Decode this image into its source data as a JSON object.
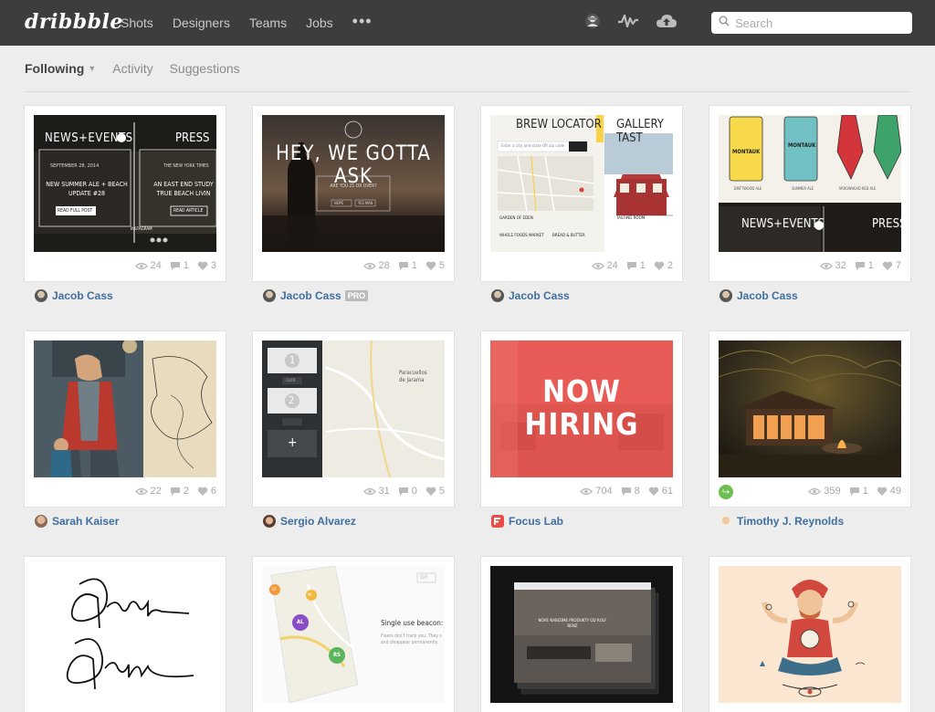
{
  "app": {
    "logo": "dribbble"
  },
  "nav": {
    "items": [
      "Shots",
      "Designers",
      "Teams",
      "Jobs"
    ],
    "more": "•••"
  },
  "search": {
    "placeholder": "Search"
  },
  "subnav": {
    "tabs": [
      "Following",
      "Activity",
      "Suggestions"
    ]
  },
  "shots": [
    {
      "views": "24",
      "comments": "1",
      "likes": "3",
      "author": "Jacob Cass",
      "thumb": {
        "left_title": "NEWS+EVENTS",
        "right_title": "PRESS",
        "date": "SEPTEMBER 28, 2014",
        "headline": "NEW SUMMER ALE + BEACH UPDATE #28",
        "cta": "READ FULL POST",
        "press_src": "THE NEW YORK TIMES",
        "press_headline": "AN EAST END STUDY TRUE BEACH LIVIN",
        "press_cta": "READ ARTICLE",
        "social": "INSTAGRAM"
      }
    },
    {
      "views": "28",
      "comments": "1",
      "likes": "5",
      "author": "Jacob Cass",
      "badge": "PRO",
      "thumb": {
        "headline": "HEY, WE GOTTA ASK",
        "question": "ARE YOU 21 OR OVER?",
        "yes": "NOPE",
        "no": "YES MAN"
      }
    },
    {
      "views": "24",
      "comments": "1",
      "likes": "2",
      "author": "Jacob Cass",
      "thumb": {
        "title": "BREW LOCATOR",
        "title2": "GALLERY TAST",
        "input": "Enter a city and state OR zip code",
        "loc1": "GARDEN OF EDEN",
        "loc2": "WHOLE FOODS MARKET",
        "loc3": "BREAD & BUTTER",
        "room": "TASTING ROOM"
      }
    },
    {
      "views": "32",
      "comments": "1",
      "likes": "7",
      "author": "Jacob Cass",
      "thumb": {
        "can1": "MONTAUK",
        "can2": "MONTAUK",
        "sub1": "DRIFTWOOD ALE",
        "sub2": "SUMMER ALE",
        "sub3": "ARROWHEAD RED ALE",
        "left_title": "NEWS+EVENTS",
        "right_title": "PRESS"
      }
    },
    {
      "views": "22",
      "comments": "2",
      "likes": "6",
      "author": "Sarah Kaiser"
    },
    {
      "views": "31",
      "comments": "0",
      "likes": "5",
      "author": "Sergio Alvarez",
      "thumb": {
        "btn1": "1",
        "btn2": "2",
        "click": "CLICK",
        "plus": "+",
        "city": "Paracuellos de Jarama"
      }
    },
    {
      "views": "704",
      "comments": "8",
      "likes": "61",
      "author": "Focus Lab",
      "thumb": {
        "line1": "NOW",
        "line2": "HIRING"
      }
    },
    {
      "views": "359",
      "comments": "1",
      "likes": "49",
      "author": "Timothy J. Reynolds"
    },
    {
      "author": ""
    },
    {
      "author": "",
      "thumb": {
        "gif": "GIF",
        "title": "Single use beacon:",
        "body": "Flaers don't track you. They s and disappear permanently.",
        "pins": [
          "AL",
          "RS",
          "MC",
          "GT"
        ]
      }
    },
    {
      "author": "",
      "thumb": {
        "caption": "NOVE NABIZIME PRODUKTY OD ROLF BENZ"
      }
    },
    {
      "author": ""
    }
  ],
  "colors": {
    "topbar": "#3d3d3d",
    "link": "#3f6f9f",
    "focus_red": "#ea4c47",
    "rebound_green": "#6bbf4e"
  }
}
